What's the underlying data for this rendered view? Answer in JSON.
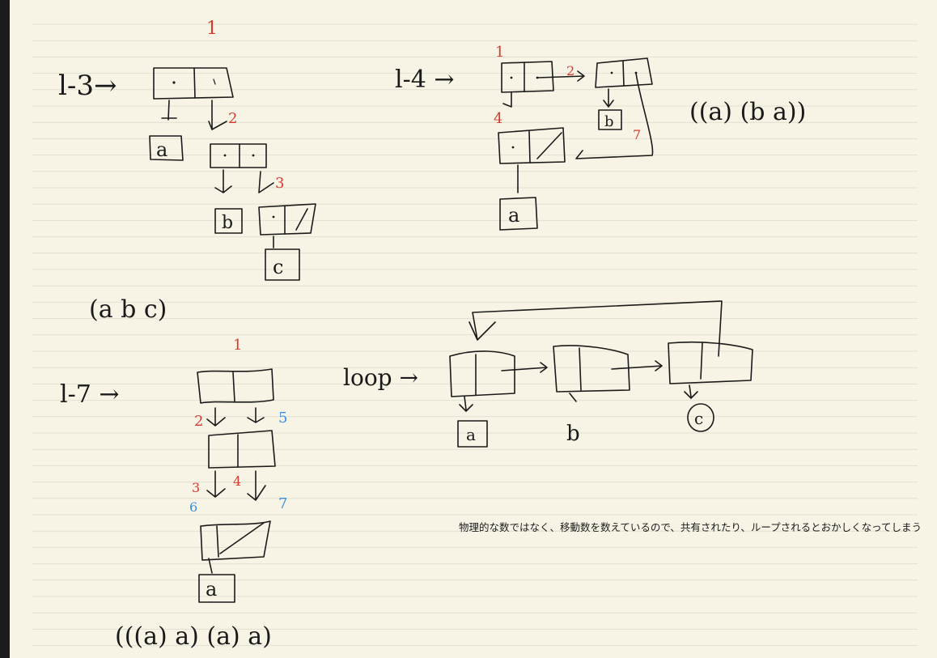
{
  "colors": {
    "paper": "#f7f4e6",
    "rule": "#e2dfd0",
    "ink": "#1a1a1a",
    "red": "#d63a2f",
    "blue": "#3a8ee0"
  },
  "top_left": {
    "var_label": "l-3→",
    "count_top": "1",
    "count_2": "2",
    "count_3": "3",
    "atom_a": "a",
    "atom_b": "b",
    "atom_c": "c",
    "result": "(a  b  c)"
  },
  "top_right": {
    "var_label": "l-4 →",
    "count_top": "1",
    "count_2": "2",
    "count_4": "4",
    "count_7": "7",
    "atom_b": "b",
    "atom_a": "a",
    "result": "((a) (b  a))"
  },
  "bottom_left": {
    "var_label": "l-7 →",
    "count_top": "1",
    "count_2": "2",
    "count_5": "5",
    "count_3": "3",
    "count_4": "4",
    "count_6": "6",
    "count_7": "7",
    "atom_a": "a",
    "result": "(((a)  a)  (a)  a)"
  },
  "bottom_right": {
    "var_label": "loop →",
    "atom_a": "a",
    "atom_b": "b",
    "atom_c": "c"
  },
  "note_text": "物理的な数ではなく、移動数を数えているので、共有されたり、ループされるとおかしくなってしまう"
}
